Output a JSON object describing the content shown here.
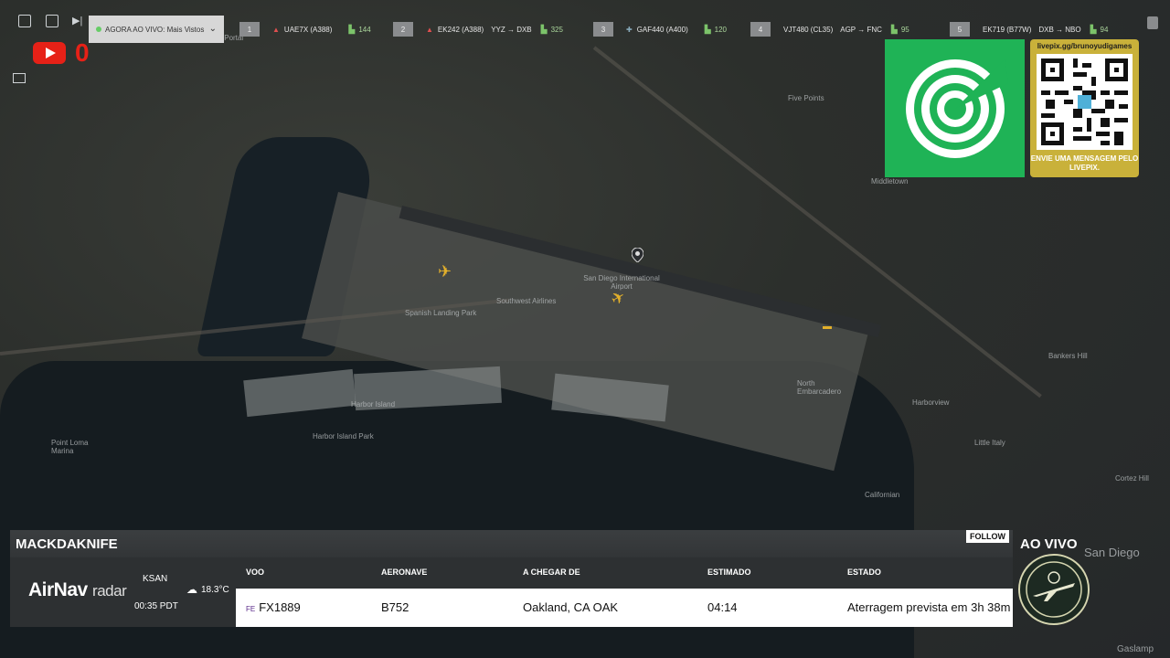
{
  "topbar": {
    "icons": [
      "collapse-icon",
      "screenshot-icon",
      "skip-icon"
    ],
    "live_label": "AGORA AO VIVO: Mais Vistos",
    "flights": [
      {
        "num": "1",
        "label": "UAE7X (A388)",
        "route": "",
        "count": "144"
      },
      {
        "num": "2",
        "label": "EK242 (A388)",
        "route": "YYZ → DXB",
        "count": "325"
      },
      {
        "num": "3",
        "label": "GAF440 (A400)",
        "route": "",
        "count": "120"
      },
      {
        "num": "4",
        "label": "VJT480 (CL35)",
        "route": "AGP → FNC",
        "count": "95"
      },
      {
        "num": "5",
        "label": "EK719 (B77W)",
        "route": "DXB → NBO",
        "count": "94"
      }
    ]
  },
  "youtube": {
    "count": "0"
  },
  "map_labels": [
    "Loma Portal",
    "Five Points",
    "Middletown",
    "Harbor Island",
    "Harbor Island Park",
    "San Diego International Airport",
    "North Embarcadero",
    "Harborview",
    "Bankers Hill",
    "Little Italy",
    "Cortez Hill",
    "Point Loma Marina",
    "Southwest Airlines",
    "Spanish Landing Park",
    "Californian",
    "San Diego",
    "Gaslamp"
  ],
  "livepix": {
    "url": "livepix.gg/brunoyudigames",
    "caption": "ENVIE UMA MENSAGEM PELO LIVEPIX."
  },
  "panel": {
    "callsign": "MACKDAKNIFE",
    "follow": "FOLLOW",
    "brand_bold": "AirNav",
    "brand_light": "radar",
    "airport": "KSAN",
    "time": "00:35 PDT",
    "temp": "18.3°C",
    "headers": {
      "voo": "VOO",
      "aeronave": "AERONAVE",
      "origem": "A CHEGAR DE",
      "estimado": "ESTIMADO",
      "estado": "ESTADO"
    },
    "row": {
      "voo": "FX1889",
      "aeronave": "B752",
      "origem": "Oakland, CA OAK",
      "estimado": "04:14",
      "estado": "Aterragem prevista em 3h 38m"
    }
  },
  "aovivo": "AO VIVO",
  "colors": {
    "accent_green": "#1fb356",
    "youtube_red": "#e62117",
    "gold": "#c9b13a",
    "plane_yellow": "#e3b02b"
  }
}
